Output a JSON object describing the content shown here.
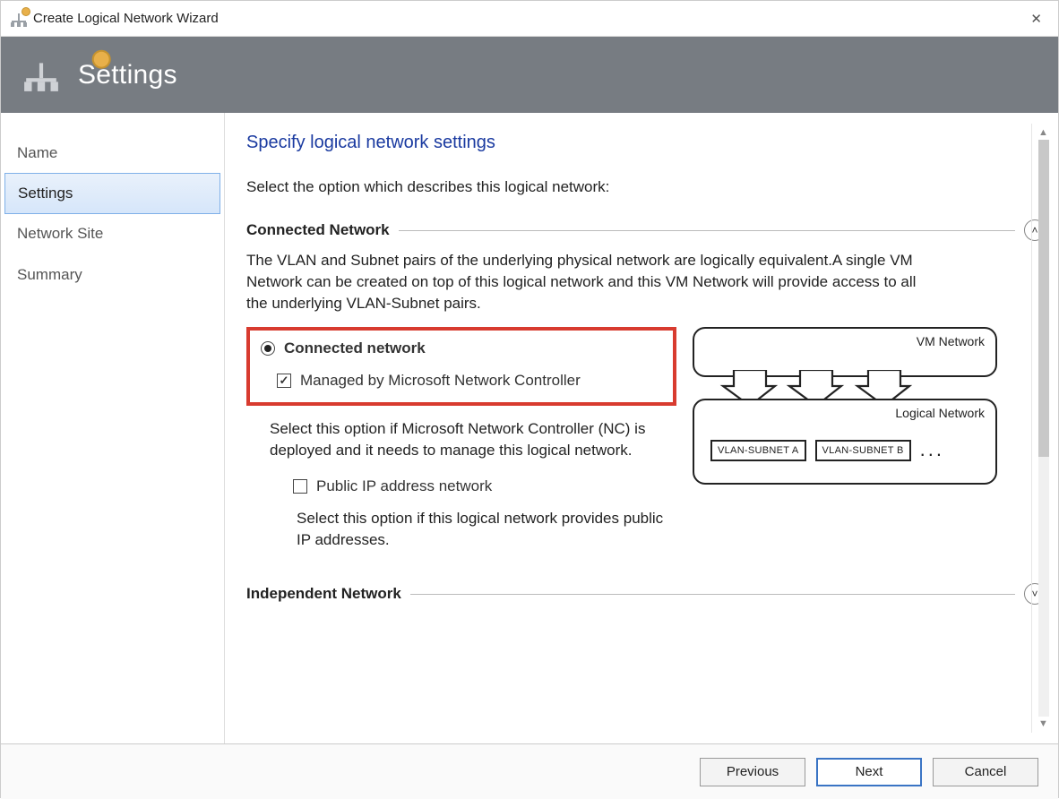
{
  "window": {
    "title": "Create Logical Network Wizard",
    "close_label": "✕"
  },
  "header": {
    "title": "Settings"
  },
  "sidebar": {
    "items": [
      {
        "label": "Name",
        "selected": false
      },
      {
        "label": "Settings",
        "selected": true
      },
      {
        "label": "Network Site",
        "selected": false
      },
      {
        "label": "Summary",
        "selected": false
      }
    ]
  },
  "main": {
    "page_title": "Specify logical network settings",
    "instruction": "Select the option which describes this logical network:",
    "sections": {
      "connected": {
        "title": "Connected Network",
        "expanded": true,
        "description": "The VLAN and Subnet pairs of the underlying physical network are logically equivalent.A single VM Network can be created on top of this logical network and this VM Network will provide access to all the underlying VLAN-Subnet pairs.",
        "radio_label": "Connected network",
        "radio_selected": true,
        "managed_by_nc_label": "Managed by Microsoft Network Controller",
        "managed_by_nc_checked": true,
        "nc_help": "Select this option if Microsoft Network Controller (NC) is deployed and it needs to manage this logical network.",
        "public_ip_label": "Public IP address network",
        "public_ip_checked": false,
        "public_ip_help": "Select this option if this logical network provides public IP addresses."
      },
      "independent": {
        "title": "Independent Network",
        "expanded": false
      }
    },
    "diagram": {
      "vm_network_label": "VM Network",
      "logical_network_label": "Logical  Network",
      "vlan_a": "VLAN-SUBNET A",
      "vlan_b": "VLAN-SUBNET B",
      "ellipsis": "..."
    }
  },
  "footer": {
    "previous": "Previous",
    "next": "Next",
    "cancel": "Cancel"
  }
}
